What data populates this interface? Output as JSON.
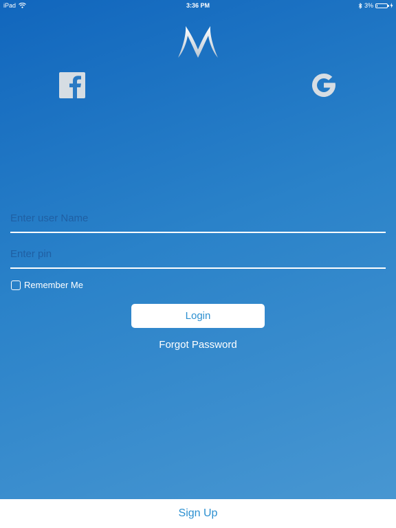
{
  "status_bar": {
    "device": "iPad",
    "time": "3:36 PM",
    "battery": "3%",
    "battery_level_percent": 3
  },
  "icons": {
    "logo": "m-logo-icon",
    "facebook": "facebook-icon",
    "google": "google-icon",
    "wifi": "wifi-icon",
    "bluetooth": "bluetooth-icon",
    "charging": "charging-bolt-icon"
  },
  "form": {
    "username_placeholder": "Enter user Name",
    "username_value": "",
    "pin_placeholder": "Enter pin",
    "pin_value": "",
    "remember_label": "Remember Me",
    "remember_checked": false,
    "login_label": "Login",
    "forgot_label": "Forgot Password"
  },
  "footer": {
    "signup_label": "Sign Up"
  },
  "colors": {
    "background_start": "#1166bd",
    "background_end": "#4a98d2",
    "accent": "#2b8fd0",
    "placeholder": "#1f5fa3",
    "white": "#ffffff"
  }
}
